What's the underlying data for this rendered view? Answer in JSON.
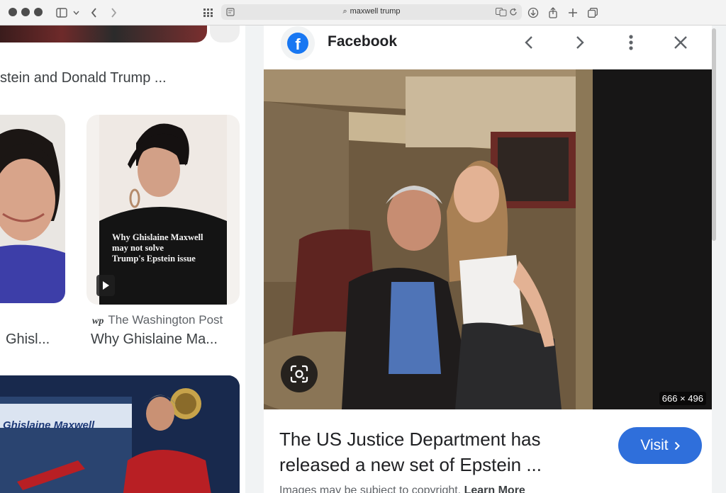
{
  "browser": {
    "address": "maxwell trump",
    "icons": [
      "sidebar-icon",
      "chevron-down-icon",
      "back-icon",
      "forward-icon",
      "grid-icon",
      "reader-icon",
      "translate-icon",
      "reload-icon",
      "download-icon",
      "share-icon",
      "new-tab-icon",
      "tabs-icon"
    ]
  },
  "results": {
    "top_caption": "stein and Donald Trump ...",
    "left_card": {
      "title": "Ghisl..."
    },
    "right_card": {
      "overlay": "Why Ghislaine Maxwell may not solve Trump's Epstein issue",
      "overlay_lines": [
        "Why Ghislaine Maxwell",
        "may not solve",
        "Trump's Epstein issue"
      ],
      "source_logo": "wp",
      "source": "The Washington Post",
      "title": "Why Ghislaine Ma..."
    },
    "bottom_card": {
      "banner": "Ghislaine Maxwell"
    }
  },
  "panel": {
    "site_name": "Facebook",
    "image_dims": "666 × 496",
    "title": "The US Justice Department has released a new set of Epstein ...",
    "visit_label": "Visit",
    "copyright_text": "Images may be subject to copyright.",
    "learn_more": "Learn More",
    "colors": {
      "facebook": "#1877f2",
      "visit": "#2f6fdb"
    }
  }
}
